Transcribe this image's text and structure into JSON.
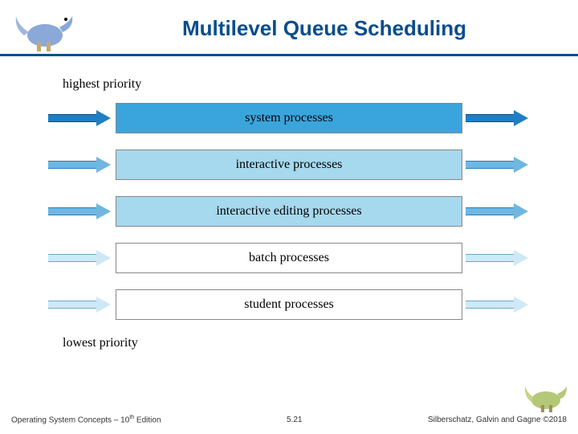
{
  "title": "Multilevel Queue Scheduling",
  "labels": {
    "highest": "highest priority",
    "lowest": "lowest priority"
  },
  "queues": [
    {
      "label": "system processes",
      "fill": "#3aa5dd",
      "arrow_fill": "#1f7fc4",
      "arrow_stroke": "#0a4d8c"
    },
    {
      "label": "interactive processes",
      "fill": "#a6d8ee",
      "arrow_fill": "#6fb7e0",
      "arrow_stroke": "#2a7fb8"
    },
    {
      "label": "interactive editing processes",
      "fill": "#a6d8ee",
      "arrow_fill": "#6fb7e0",
      "arrow_stroke": "#2a7fb8"
    },
    {
      "label": "batch processes",
      "fill": "#ffffff",
      "arrow_fill": "#cfe8f5",
      "arrow_stroke": "#6fa8c8"
    },
    {
      "label": "student processes",
      "fill": "#ffffff",
      "arrow_fill": "#cfe8f5",
      "arrow_stroke": "#6fa8c8"
    }
  ],
  "footer": {
    "left_prefix": "Operating System Concepts – 10",
    "left_suffix": " Edition",
    "left_sup": "th",
    "center": "5.21",
    "right": "Silberschatz, Galvin and Gagne ©2018"
  },
  "icons": {
    "dino_left": "dinosaur-blue",
    "dino_right": "dinosaur-green"
  }
}
